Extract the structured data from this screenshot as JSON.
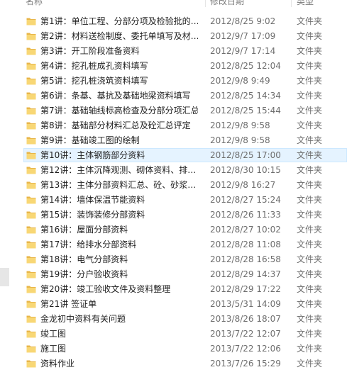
{
  "columns": {
    "name": "名称",
    "date": "修改日期",
    "type": "类型"
  },
  "rows": [
    {
      "name": "第1讲：单位工程、分部分项及检验批的…",
      "date": "2012/8/25 9:02",
      "type": "文件夹"
    },
    {
      "name": "第2讲：材料送检制度、委托单填写及材…",
      "date": "2012/9/7 17:09",
      "type": "文件夹"
    },
    {
      "name": "第3讲：开工阶段准备资料",
      "date": "2012/9/7 17:14",
      "type": "文件夹"
    },
    {
      "name": "第4讲：挖孔桩成孔资料填写",
      "date": "2012/8/25 12:04",
      "type": "文件夹"
    },
    {
      "name": "第5讲：挖孔桩浇筑资料填写",
      "date": "2012/9/8 9:49",
      "type": "文件夹"
    },
    {
      "name": "第6讲：条基、基抗及基础地梁资料填写",
      "date": "2012/8/25 14:34",
      "type": "文件夹"
    },
    {
      "name": "第7讲：基础轴线标高检查及分部分项汇总",
      "date": "2012/8/25 15:44",
      "type": "文件夹"
    },
    {
      "name": "第8讲：基础部分材料汇总及砼汇总评定",
      "date": "2012/9/8 9:58",
      "type": "文件夹"
    },
    {
      "name": "第9讲：基础竣工图的绘制",
      "date": "2012/9/8 9:58",
      "type": "文件夹"
    },
    {
      "name": "第10讲：主体钢筋部分资料",
      "date": "2012/8/25 17:00",
      "type": "文件夹",
      "selected": true
    },
    {
      "name": "第12讲：主体沉降观测、砌体资料、排…",
      "date": "2012/8/30 10:15",
      "type": "文件夹"
    },
    {
      "name": "第13讲：主体分部资料汇总、砼、砂浆…",
      "date": "2012/9/8 16:27",
      "type": "文件夹"
    },
    {
      "name": "第14讲：墙体保温节能资料",
      "date": "2012/8/27 15:24",
      "type": "文件夹"
    },
    {
      "name": "第15讲：装饰装修分部资料",
      "date": "2012/8/26 11:33",
      "type": "文件夹"
    },
    {
      "name": "第16讲：屋面分部资料",
      "date": "2012/8/27 10:02",
      "type": "文件夹"
    },
    {
      "name": "第17讲：给排水分部资料",
      "date": "2012/8/28 11:08",
      "type": "文件夹"
    },
    {
      "name": "第18讲：电气分部资料",
      "date": "2012/8/28 16:58",
      "type": "文件夹"
    },
    {
      "name": "第19讲：分户验收资料",
      "date": "2012/8/29 14:37",
      "type": "文件夹"
    },
    {
      "name": "第20讲：竣工验收文件及资料整理",
      "date": "2012/8/29 17:22",
      "type": "文件夹"
    },
    {
      "name": "第21讲 签证单",
      "date": "2013/5/31 14:09",
      "type": "文件夹"
    },
    {
      "name": "金龙初中资料有关问题",
      "date": "2013/8/26 18:07",
      "type": "文件夹"
    },
    {
      "name": "竣工图",
      "date": "2013/7/22 12:07",
      "type": "文件夹"
    },
    {
      "name": "施工图",
      "date": "2013/7/22 12:06",
      "type": "文件夹"
    },
    {
      "name": "资料作业",
      "date": "2013/7/26 15:29",
      "type": "文件夹"
    }
  ],
  "colors": {
    "folder_fill": "#f8d775",
    "folder_tab": "#e8b64a",
    "selection_bg": "#e5f3ff",
    "selection_border": "#cce8ff"
  },
  "icons": {
    "folder": "folder-icon"
  }
}
